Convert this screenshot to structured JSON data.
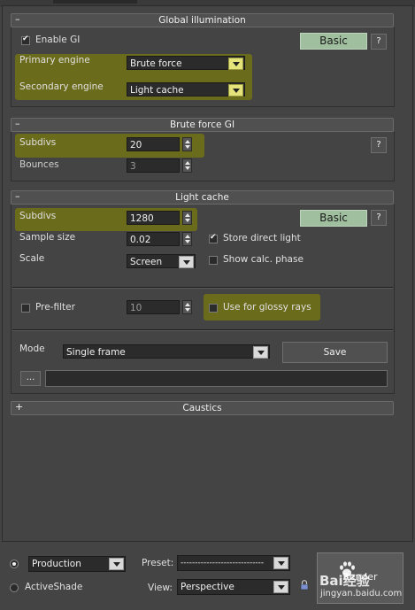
{
  "global_illumination": {
    "title": "Global illumination",
    "collapse_sign": "–",
    "enable_gi_label": "Enable GI",
    "enable_gi_checked": true,
    "mode_button": "Basic",
    "help_button": "?",
    "primary_engine_label": "Primary engine",
    "primary_engine_value": "Brute force",
    "secondary_engine_label": "Secondary engine",
    "secondary_engine_value": "Light cache"
  },
  "brute_force_gi": {
    "title": "Brute force GI",
    "collapse_sign": "–",
    "subdivs_label": "Subdivs",
    "subdivs_value": "20",
    "bounces_label": "Bounces",
    "bounces_value": "3",
    "help_button": "?"
  },
  "light_cache": {
    "title": "Light cache",
    "collapse_sign": "–",
    "subdivs_label": "Subdivs",
    "subdivs_value": "1280",
    "mode_button": "Basic",
    "help_button": "?",
    "sample_size_label": "Sample size",
    "sample_size_value": "0.02",
    "store_direct_light_label": "Store direct light",
    "store_direct_light_checked": true,
    "scale_label": "Scale",
    "scale_value": "Screen",
    "show_calc_phase_label": "Show calc. phase",
    "show_calc_phase_checked": false,
    "prefilter_label": "Pre-filter",
    "prefilter_checked": false,
    "prefilter_value": "10",
    "use_glossy_label": "Use for glossy rays",
    "use_glossy_checked": false,
    "mode_label": "Mode",
    "mode_value": "Single frame",
    "save_button": "Save",
    "browse_button": "...",
    "file_path": ""
  },
  "caustics": {
    "title": "Caustics",
    "expand_sign": "+"
  },
  "bottom_bar": {
    "production_label": "Production",
    "production_selected": true,
    "activeshade_label": "ActiveShade",
    "preset_label": "Preset:",
    "preset_value": "-----------------------------",
    "view_label": "View:",
    "view_value": "Perspective",
    "render_button": "Render"
  },
  "watermark": {
    "brand": "Bai经验",
    "url": "jingyan.baidu.com"
  },
  "colors": {
    "highlight": "#6b6b1c",
    "basic_button": "#9fbf9f",
    "panel_bg": "#444444"
  }
}
